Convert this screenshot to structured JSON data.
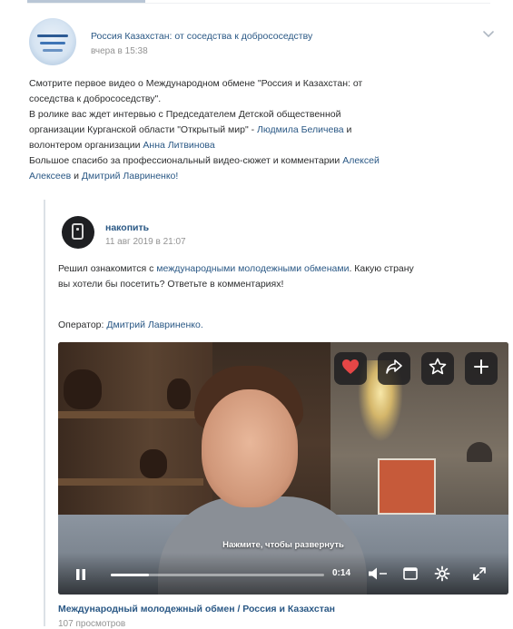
{
  "post": {
    "author": "Россия Казахстан: от соседства к добрососедству",
    "date": "вчера в 15:38",
    "text": {
      "line1": "Смотрите первое видео о Международном обмене \"Россия и Казахстан: от",
      "line2": "соседства к добрососедству\".",
      "line3": "В ролике вас ждет интервью с Председателем Детской общественной",
      "line4_a": "организации Курганской области \"Открытый мир\" - ",
      "line4_link": "Людмила Беличева",
      "line4_b": " и",
      "line5_a": "волонтером организации ",
      "line5_link": "Анна Литвинова",
      "line6_a": "Большое спасибо за профессиональный видео-сюжет и комментарии ",
      "line6_link": "Алексей",
      "line7_link1": "Алексеев",
      "line7_mid": " и ",
      "line7_link2": "Дмитрий Лавриненко!"
    }
  },
  "repost": {
    "author": "накопить",
    "date": "11 авг 2019 в 21:07",
    "text": {
      "line1_a": "Решил ознакомится с ",
      "line1_link": "международными молодежными обменами",
      "line1_b": ". Какую страну",
      "line2": "вы хотели бы посетить? Ответьте в комментариях!"
    },
    "operator_label": "Оператор: ",
    "operator_link": "Дмитрий Лавриненко."
  },
  "video": {
    "overlay_hint": "Нажмите, чтобы развернуть",
    "time": "0:14",
    "progress": 0.18,
    "title": "Международный молодежный обмен / Россия и Казахстан",
    "views": "107 просмотров",
    "like_color": "#e64646"
  }
}
